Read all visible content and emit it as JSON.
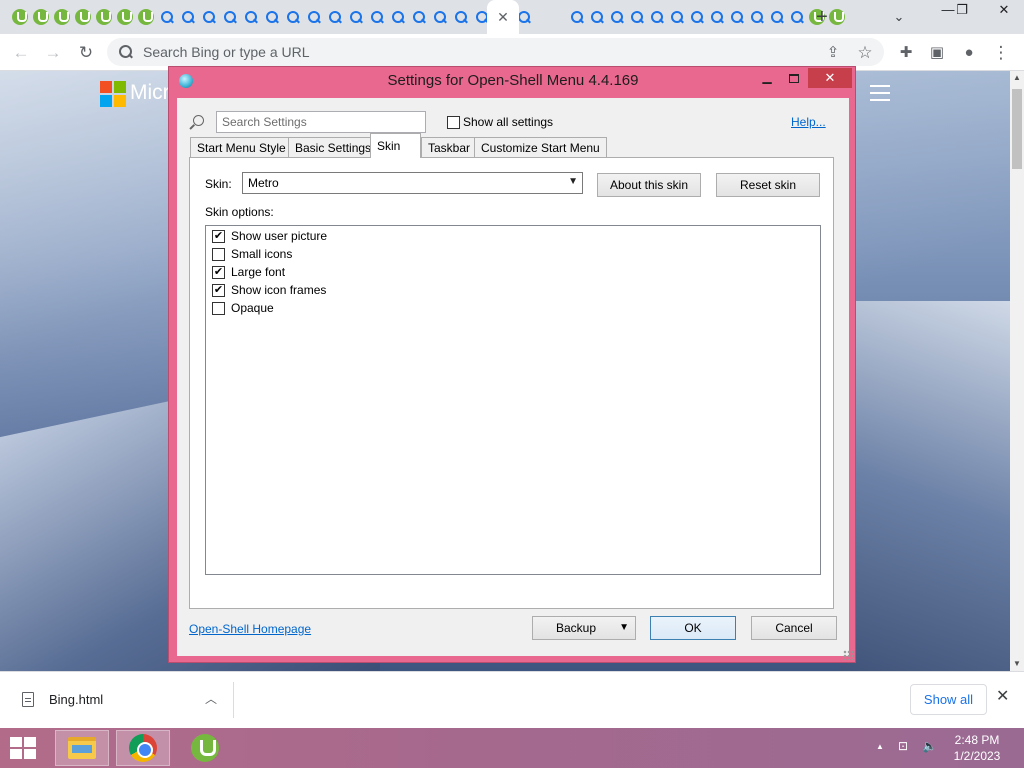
{
  "browser": {
    "tabs": {
      "favicons": [
        "utorrent-icon",
        "utorrent-icon",
        "utorrent-icon",
        "utorrent-icon",
        "utorrent-icon",
        "utorrent-icon",
        "utorrent-icon",
        "search-icon",
        "search-icon",
        "search-icon",
        "search-icon",
        "search-icon",
        "search-icon",
        "search-icon",
        "search-icon",
        "search-icon",
        "search-icon",
        "search-icon",
        "search-icon",
        "search-icon",
        "search-icon",
        "search-icon",
        "search-icon",
        "search-icon",
        "search-icon",
        "close-icon",
        "search-icon",
        "search-icon",
        "search-icon",
        "search-icon",
        "search-icon",
        "search-icon",
        "search-icon",
        "search-icon",
        "search-icon",
        "search-icon",
        "search-icon",
        "search-icon",
        "utorrent-icon",
        "utorrent-icon"
      ],
      "active_tab_close": "✕",
      "new_tab": "+",
      "tab_search": "⌄"
    },
    "window_controls": {
      "minimize": "—",
      "restore": "❐",
      "close": "✕"
    },
    "toolbar": {
      "back": "←",
      "forward": "→",
      "reload": "↻",
      "omnibox_placeholder": "Search Bing or type a URL",
      "share": "⇪",
      "bookmark": "☆",
      "extensions": "✚",
      "side_panel": "▣",
      "profile": "●",
      "menu": "⋮"
    },
    "page": {
      "brand_text": "Micr"
    },
    "downloads": {
      "file_name": "Bing.html",
      "chevron": "︿",
      "show_all": "Show all",
      "close": "✕"
    }
  },
  "dialog": {
    "title": "Settings for Open-Shell Menu 4.4.169",
    "min": "▁",
    "close": "✕",
    "search_placeholder": "Search Settings",
    "show_all_settings": "Show all settings",
    "show_all_checked": false,
    "help": "Help...",
    "tabs": [
      {
        "label": "Start Menu Style",
        "active": false
      },
      {
        "label": "Basic Settings",
        "active": false
      },
      {
        "label": "Skin",
        "active": true
      },
      {
        "label": "Taskbar",
        "active": false
      },
      {
        "label": "Customize Start Menu",
        "active": false
      }
    ],
    "skin": {
      "label": "Skin:",
      "value": "Metro",
      "about_button": "About this skin",
      "reset_button": "Reset skin",
      "options_label": "Skin options:",
      "options": [
        {
          "label": "Show user picture",
          "checked": true
        },
        {
          "label": "Small icons",
          "checked": false
        },
        {
          "label": "Large font",
          "checked": true
        },
        {
          "label": "Show icon frames",
          "checked": true
        },
        {
          "label": "Opaque",
          "checked": false
        }
      ]
    },
    "footer": {
      "homepage_link": "Open-Shell Homepage",
      "backup": "Backup",
      "ok": "OK",
      "cancel": "Cancel"
    }
  },
  "taskbar": {
    "apps": [
      "file-explorer-icon",
      "chrome-icon",
      "utorrent-icon"
    ],
    "tray": {
      "chevron": "▲",
      "network": "⊡",
      "volume": "🔈"
    },
    "time": "2:48 PM",
    "date": "1/2/2023"
  },
  "colors": {
    "dialog_frame": "#e9688f",
    "taskbar": "#a7698d",
    "link": "#0066cc",
    "chrome_accent": "#1a73e8"
  }
}
